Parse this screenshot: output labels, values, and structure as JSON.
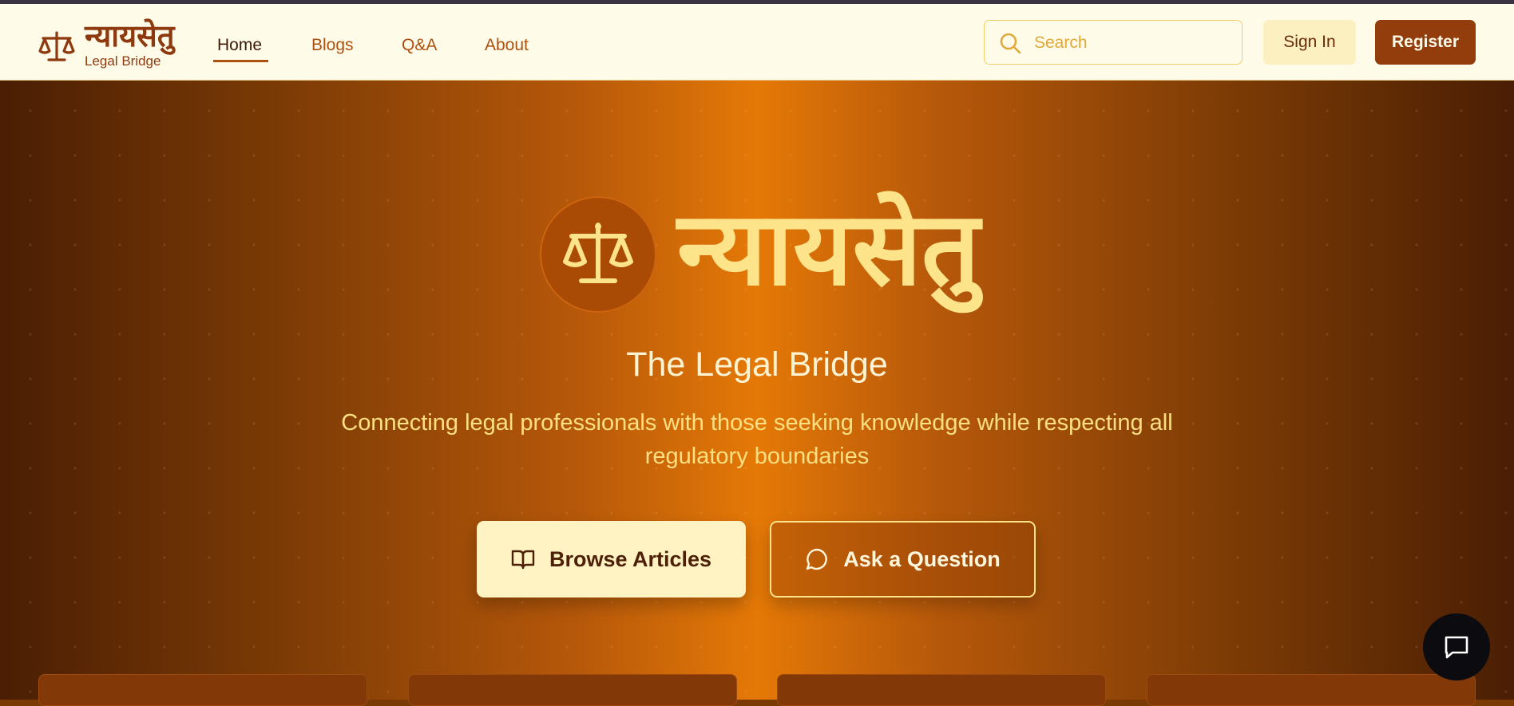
{
  "brand": {
    "name": "न्यायसेतु",
    "tagline": "Legal Bridge"
  },
  "nav": {
    "items": [
      {
        "label": "Home",
        "active": true
      },
      {
        "label": "Blogs",
        "active": false
      },
      {
        "label": "Q&A",
        "active": false
      },
      {
        "label": "About",
        "active": false
      }
    ]
  },
  "search": {
    "placeholder": "Search",
    "value": "",
    "icon": "search-icon"
  },
  "auth": {
    "signin_label": "Sign In",
    "register_label": "Register"
  },
  "hero": {
    "title": "न्यायसेतु",
    "subtitle": "The Legal Bridge",
    "description": "Connecting legal professionals with those seeking knowledge while respecting all regulatory boundaries",
    "emblem_icon": "scales-icon",
    "buttons": {
      "browse_label": "Browse Articles",
      "browse_icon": "book-open-icon",
      "ask_label": "Ask a Question",
      "ask_icon": "message-circle-icon"
    }
  },
  "chat_fab": {
    "icon": "chat-icon"
  },
  "colors": {
    "nav_bg": "#fffbe9",
    "brand_text": "#8e3a0e",
    "accent": "#933c0c",
    "hero_center": "#e57907",
    "hero_edge": "#4a1e04",
    "hero_title": "#fde38a"
  }
}
